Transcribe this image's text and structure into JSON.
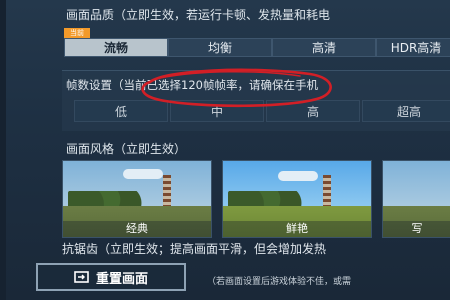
{
  "quality": {
    "title": "画面品质（立即生效，若运行卡顿、发热量和耗电",
    "current_tag": "当前",
    "options": [
      "流畅",
      "均衡",
      "高清",
      "HDR高清"
    ],
    "selected": "流畅"
  },
  "fps": {
    "text": "帧数设置（当前已选择120帧帧率，请确保在手机",
    "options": [
      "低",
      "中",
      "高",
      "超高"
    ]
  },
  "style": {
    "title": "画面风格（立即生效）",
    "options": [
      "经典",
      "鲜艳",
      "写"
    ]
  },
  "antialias": {
    "text": "抗锯齿（立即生效；提高画面平滑，但会增加发热"
  },
  "reset": {
    "label": "重置画面",
    "note": "（若画面设置后游戏体验不佳，或需"
  },
  "colors": {
    "annotation": "#d21f26",
    "tag": "#f39a2a"
  }
}
